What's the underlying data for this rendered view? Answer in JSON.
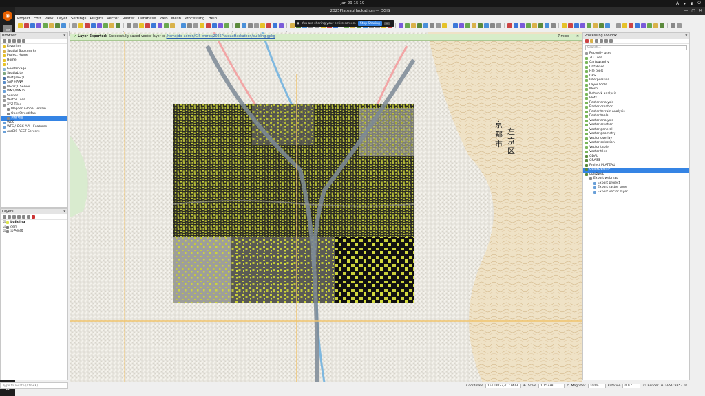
{
  "system": {
    "clock": "Jan 29  15:19",
    "tray_lang": "A"
  },
  "window": {
    "title": "2025PlateauHackathon — QGIS"
  },
  "menu": [
    "Project",
    "Edit",
    "View",
    "Layer",
    "Settings",
    "Plugins",
    "Vector",
    "Raster",
    "Database",
    "Web",
    "Mesh",
    "Processing",
    "Help"
  ],
  "share": {
    "text": "You are sharing your entire screen.",
    "stop": "Stop Sharing"
  },
  "browser": {
    "title": "Browser",
    "items": [
      {
        "label": "Favorites",
        "indent": 0,
        "color": "#e6c229"
      },
      {
        "label": "Spatial Bookmarks",
        "indent": 0,
        "color": "#d9b24a"
      },
      {
        "label": "Project Home",
        "indent": 0,
        "color": "#e6c229"
      },
      {
        "label": "Home",
        "indent": 0,
        "color": "#e6c229"
      },
      {
        "label": "/",
        "indent": 0,
        "color": "#e6c229"
      },
      {
        "label": "GeoPackage",
        "indent": 0,
        "color": "#8ab6d6"
      },
      {
        "label": "SpatiaLite",
        "indent": 0,
        "color": "#7fa87f"
      },
      {
        "label": "PostgreSQL",
        "indent": 0,
        "color": "#4a6fa5"
      },
      {
        "label": "SAP HANA",
        "indent": 0,
        "color": "#5b8dc9"
      },
      {
        "label": "MS SQL Server",
        "indent": 0,
        "color": "#8a8a8a"
      },
      {
        "label": "WMS/WMTS",
        "indent": 0,
        "color": "#6aa0d8"
      },
      {
        "label": "Scenes",
        "indent": 0,
        "color": "#999"
      },
      {
        "label": "Vector Tiles",
        "indent": 0,
        "color": "#999"
      },
      {
        "label": "XYZ Tiles",
        "indent": 0,
        "color": "#999"
      },
      {
        "label": "Mapzen Global Terrain",
        "indent": 1,
        "color": "#888"
      },
      {
        "label": "OpenStreetMap",
        "indent": 1,
        "color": "#888"
      },
      {
        "label": "淡色地図",
        "indent": 1,
        "color": "#888",
        "selected": true
      },
      {
        "label": "WCS",
        "indent": 0,
        "color": "#6aa0d8"
      },
      {
        "label": "WFS / OGC API - Features",
        "indent": 0,
        "color": "#6aa0d8"
      },
      {
        "label": "ArcGIS REST Servers",
        "indent": 0,
        "color": "#6aa0d8"
      }
    ]
  },
  "layers": {
    "title": "Layers",
    "items": [
      {
        "label": "building",
        "bold": true,
        "color": "#dde54a"
      },
      {
        "label": "dem",
        "bold": false,
        "color": "#777"
      },
      {
        "label": "淡色地図",
        "bold": false,
        "color": "#888"
      }
    ]
  },
  "locator": {
    "placeholder": "Type to locate (Ctrl+K)"
  },
  "message": {
    "title": "Layer Exported:",
    "text": "Successfully saved vector layer to",
    "path": "/home/dx_admin/GIS_works/2025PlateauHackathon/building.gpkg",
    "more": "7 more"
  },
  "map": {
    "kanji_ward": [
      "京",
      "都",
      "市"
    ],
    "kanji_ward2": [
      "左",
      "京",
      "区"
    ]
  },
  "processing": {
    "title": "Processing Toolbox",
    "search_placeholder": "Search...",
    "items": [
      {
        "label": "Recently used",
        "indent": 0,
        "color": "#999"
      },
      {
        "label": "3D Tiles",
        "indent": 0,
        "color": "#7ab65a"
      },
      {
        "label": "Cartography",
        "indent": 0,
        "color": "#7ab65a"
      },
      {
        "label": "Database",
        "indent": 0,
        "color": "#7ab65a"
      },
      {
        "label": "File tools",
        "indent": 0,
        "color": "#7ab65a"
      },
      {
        "label": "GPS",
        "indent": 0,
        "color": "#7ab65a"
      },
      {
        "label": "Interpolation",
        "indent": 0,
        "color": "#7ab65a"
      },
      {
        "label": "Layer tools",
        "indent": 0,
        "color": "#7ab65a"
      },
      {
        "label": "Mesh",
        "indent": 0,
        "color": "#7ab65a"
      },
      {
        "label": "Network analysis",
        "indent": 0,
        "color": "#7ab65a"
      },
      {
        "label": "Plots",
        "indent": 0,
        "color": "#7ab65a"
      },
      {
        "label": "Raster analysis",
        "indent": 0,
        "color": "#7ab65a"
      },
      {
        "label": "Raster creation",
        "indent": 0,
        "color": "#7ab65a"
      },
      {
        "label": "Raster terrain analysis",
        "indent": 0,
        "color": "#7ab65a"
      },
      {
        "label": "Raster tools",
        "indent": 0,
        "color": "#7ab65a"
      },
      {
        "label": "Vector analysis",
        "indent": 0,
        "color": "#7ab65a"
      },
      {
        "label": "Vector creation",
        "indent": 0,
        "color": "#7ab65a"
      },
      {
        "label": "Vector general",
        "indent": 0,
        "color": "#7ab65a"
      },
      {
        "label": "Vector geometry",
        "indent": 0,
        "color": "#7ab65a"
      },
      {
        "label": "Vector overlay",
        "indent": 0,
        "color": "#7ab65a"
      },
      {
        "label": "Vector selection",
        "indent": 0,
        "color": "#7ab65a"
      },
      {
        "label": "Vector table",
        "indent": 0,
        "color": "#7ab65a"
      },
      {
        "label": "Vector tiles",
        "indent": 0,
        "color": "#7ab65a"
      },
      {
        "label": "GDAL",
        "indent": 0,
        "color": "#5b8a3c"
      },
      {
        "label": "GRASS",
        "indent": 0,
        "color": "#5b8a3c"
      },
      {
        "label": "Project PLATEAU",
        "indent": 0,
        "color": "#5b8a3c"
      },
      {
        "label": "QuickDEM4JP",
        "indent": 0,
        "color": "#5b8a3c",
        "selected": true
      },
      {
        "label": "qgis2web",
        "indent": 0,
        "color": "#5b8a3c"
      },
      {
        "label": "Export webmap",
        "indent": 1,
        "color": "#888"
      },
      {
        "label": "Export project",
        "indent": 2,
        "color": "#6aa0d8"
      },
      {
        "label": "Export raster layer",
        "indent": 2,
        "color": "#6aa0d8"
      },
      {
        "label": "Export vector layer",
        "indent": 2,
        "color": "#6aa0d8"
      }
    ]
  },
  "status": {
    "coordinate_label": "Coordinate",
    "coordinate": "15118823,4177423",
    "scale_label": "Scale",
    "scale": "1:15338",
    "magnifier_label": "Magnifier",
    "magnifier": "100%",
    "rotation_label": "Rotation",
    "rotation": "0.0 °",
    "render_label": "Render",
    "crs": "EPSG:3857"
  }
}
